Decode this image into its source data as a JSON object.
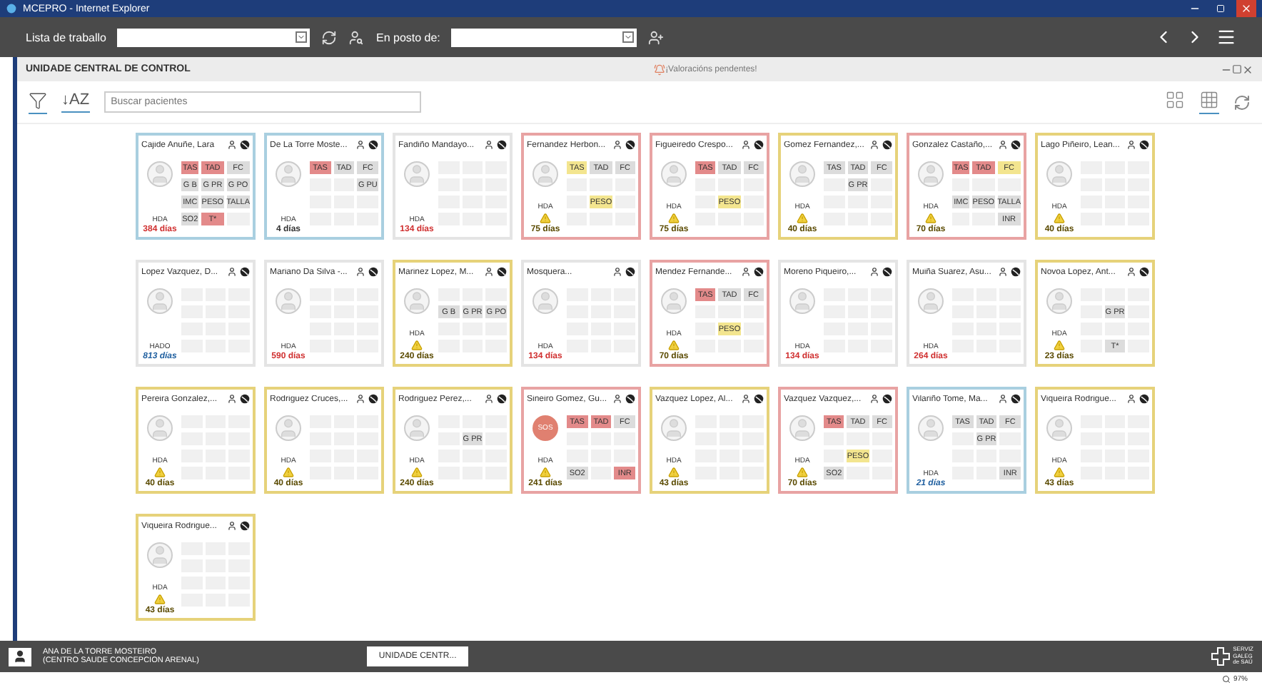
{
  "window": {
    "title": "MCEPRO - Internet Explorer"
  },
  "toolbar": {
    "worklist_label": "Lista de traballo",
    "post_label": "En posto de:"
  },
  "section": {
    "title": "UNIDADE CENTRAL DE CONTROL",
    "notice": "¡Valoracións pendentes!"
  },
  "filter_bar": {
    "sort": "↓AZ",
    "search": {
      "placeholder": "Buscar pacientes"
    },
    "views": [
      {
        "kind": "large",
        "selected": false
      },
      {
        "kind": "small",
        "selected": true
      }
    ]
  },
  "patients": [
    {
      "name": "Cajide Anuñe, Lara",
      "color": "#a9cfe0",
      "avatar": {
        "kind": "photo"
      },
      "program": "HDA",
      "warning": false,
      "days": {
        "text": "384 días",
        "color": "#d03030",
        "italic": false
      },
      "rows": [
        [
          {
            "text": "TAS",
            "kind": "alarm"
          },
          {
            "text": "TAD",
            "kind": "alarm"
          },
          {
            "text": "FC",
            "kind": "normal"
          }
        ],
        [
          {
            "text": "G B",
            "kind": "normal"
          },
          {
            "text": "G PR",
            "kind": "normal"
          },
          {
            "text": "G PO",
            "kind": "normal"
          }
        ],
        [
          {
            "text": "IMC",
            "kind": "normal"
          },
          {
            "text": "PESO",
            "kind": "normal"
          },
          {
            "text": "TALLA",
            "kind": "normal"
          }
        ],
        [
          {
            "text": "SO2",
            "kind": "normal"
          },
          {
            "text": "T*",
            "kind": "alarm"
          },
          {
            "kind": "empty"
          }
        ]
      ]
    },
    {
      "name": "De La Torre Moste...",
      "color": "#a9cfe0",
      "avatar": {
        "kind": "photo"
      },
      "program": "HDA",
      "warning": false,
      "days": {
        "text": "4 días",
        "color": "#333333",
        "italic": false
      },
      "rows": [
        [
          {
            "text": "TAS",
            "kind": "alarm"
          },
          {
            "text": "TAD",
            "kind": "normal"
          },
          {
            "text": "FC",
            "kind": "normal"
          }
        ],
        [
          {
            "kind": "empty"
          },
          {
            "kind": "empty"
          },
          {
            "text": "G PU",
            "kind": "normal"
          }
        ],
        [
          {
            "kind": "empty"
          },
          {
            "kind": "empty"
          },
          {
            "kind": "empty"
          }
        ],
        [
          {
            "kind": "empty"
          },
          {
            "kind": "empty"
          },
          {
            "kind": "empty"
          }
        ]
      ]
    },
    {
      "name": "Fandiño Mandayo...",
      "color": "#e4e4e4",
      "avatar": {
        "kind": "photo"
      },
      "program": "HDA",
      "warning": false,
      "days": {
        "text": "134 días",
        "color": "#d03030",
        "italic": false
      },
      "rows": [
        [
          {
            "kind": "empty"
          },
          {
            "kind": "empty"
          },
          {
            "kind": "empty"
          }
        ],
        [
          {
            "kind": "empty"
          },
          {
            "kind": "empty"
          },
          {
            "kind": "empty"
          }
        ],
        [
          {
            "kind": "empty"
          },
          {
            "kind": "empty"
          },
          {
            "kind": "empty"
          }
        ],
        [
          {
            "kind": "empty"
          },
          {
            "kind": "empty"
          },
          {
            "kind": "empty"
          }
        ]
      ]
    },
    {
      "name": "Fernandez Herbon...",
      "color": "#e8a3a3",
      "avatar": {
        "kind": "photo"
      },
      "program": "HDA",
      "warning": true,
      "days": {
        "text": "75 días",
        "color": "#5a4a00",
        "italic": false
      },
      "rows": [
        [
          {
            "text": "TAS",
            "kind": "warning"
          },
          {
            "text": "TAD",
            "kind": "normal"
          },
          {
            "text": "FC",
            "kind": "normal"
          }
        ],
        [
          {
            "kind": "empty"
          },
          {
            "kind": "empty"
          },
          {
            "kind": "empty"
          }
        ],
        [
          {
            "kind": "empty"
          },
          {
            "text": "PESO",
            "kind": "warning"
          },
          {
            "kind": "empty"
          }
        ],
        [
          {
            "kind": "empty"
          },
          {
            "kind": "empty"
          },
          {
            "kind": "empty"
          }
        ]
      ]
    },
    {
      "name": "Figueiredo Crespo...",
      "color": "#e8a3a3",
      "avatar": {
        "kind": "photo"
      },
      "program": "HDA",
      "warning": true,
      "days": {
        "text": "75 días",
        "color": "#5a4a00",
        "italic": false
      },
      "rows": [
        [
          {
            "text": "TAS",
            "kind": "alarm"
          },
          {
            "text": "TAD",
            "kind": "normal"
          },
          {
            "text": "FC",
            "kind": "normal"
          }
        ],
        [
          {
            "kind": "empty"
          },
          {
            "kind": "empty"
          },
          {
            "kind": "empty"
          }
        ],
        [
          {
            "kind": "empty"
          },
          {
            "text": "PESO",
            "kind": "warning"
          },
          {
            "kind": "empty"
          }
        ],
        [
          {
            "kind": "empty"
          },
          {
            "kind": "empty"
          },
          {
            "kind": "empty"
          }
        ]
      ]
    },
    {
      "name": "Gomez Fernandez,...",
      "color": "#e6d27a",
      "avatar": {
        "kind": "photo"
      },
      "program": "HDA",
      "warning": true,
      "days": {
        "text": "40 días",
        "color": "#5a4a00",
        "italic": false
      },
      "rows": [
        [
          {
            "text": "TAS",
            "kind": "normal"
          },
          {
            "text": "TAD",
            "kind": "normal"
          },
          {
            "text": "FC",
            "kind": "normal"
          }
        ],
        [
          {
            "kind": "empty"
          },
          {
            "text": "G PR",
            "kind": "normal"
          },
          {
            "kind": "empty"
          }
        ],
        [
          {
            "kind": "empty"
          },
          {
            "kind": "empty"
          },
          {
            "kind": "empty"
          }
        ],
        [
          {
            "kind": "empty"
          },
          {
            "kind": "empty"
          },
          {
            "kind": "empty"
          }
        ]
      ]
    },
    {
      "name": "Gonzalez Castaño,...",
      "color": "#e8a3a3",
      "avatar": {
        "kind": "photo"
      },
      "program": "HDA",
      "warning": true,
      "days": {
        "text": "70 días",
        "color": "#5a4a00",
        "italic": false
      },
      "rows": [
        [
          {
            "text": "TAS",
            "kind": "alarm"
          },
          {
            "text": "TAD",
            "kind": "alarm"
          },
          {
            "text": "FC",
            "kind": "warning"
          }
        ],
        [
          {
            "kind": "empty"
          },
          {
            "kind": "empty"
          },
          {
            "kind": "empty"
          }
        ],
        [
          {
            "text": "IMC",
            "kind": "normal"
          },
          {
            "text": "PESO",
            "kind": "normal"
          },
          {
            "text": "TALLA",
            "kind": "normal"
          }
        ],
        [
          {
            "kind": "empty"
          },
          {
            "kind": "empty"
          },
          {
            "text": "INR",
            "kind": "normal"
          }
        ]
      ]
    },
    {
      "name": "Lago Piñeiro, Lean...",
      "color": "#e6d27a",
      "avatar": {
        "kind": "photo"
      },
      "program": "HDA",
      "warning": true,
      "days": {
        "text": "40 días",
        "color": "#5a4a00",
        "italic": false
      },
      "rows": [
        [
          {
            "kind": "empty"
          },
          {
            "kind": "empty"
          },
          {
            "kind": "empty"
          }
        ],
        [
          {
            "kind": "empty"
          },
          {
            "kind": "empty"
          },
          {
            "kind": "empty"
          }
        ],
        [
          {
            "kind": "empty"
          },
          {
            "kind": "empty"
          },
          {
            "kind": "empty"
          }
        ],
        [
          {
            "kind": "empty"
          },
          {
            "kind": "empty"
          },
          {
            "kind": "empty"
          }
        ]
      ]
    },
    {
      "name": "Lopez Vazquez, D...",
      "color": "#e4e4e4",
      "avatar": {
        "kind": "photo"
      },
      "program": "HADO",
      "warning": false,
      "days": {
        "text": "813 días",
        "color": "#2060a0",
        "italic": true
      },
      "rows": [
        [
          {
            "kind": "empty"
          },
          {
            "kind": "empty"
          },
          {
            "kind": "empty"
          }
        ],
        [
          {
            "kind": "empty"
          },
          {
            "kind": "empty"
          },
          {
            "kind": "empty"
          }
        ],
        [
          {
            "kind": "empty"
          },
          {
            "kind": "empty"
          },
          {
            "kind": "empty"
          }
        ],
        [
          {
            "kind": "empty"
          },
          {
            "kind": "empty"
          },
          {
            "kind": "empty"
          }
        ]
      ]
    },
    {
      "name": "Mariano Da Silva -...",
      "color": "#e4e4e4",
      "avatar": {
        "kind": "photo"
      },
      "program": "HDA",
      "warning": false,
      "days": {
        "text": "590 días",
        "color": "#d03030",
        "italic": false
      },
      "rows": [
        [
          {
            "kind": "empty"
          },
          {
            "kind": "empty"
          },
          {
            "kind": "empty"
          }
        ],
        [
          {
            "kind": "empty"
          },
          {
            "kind": "empty"
          },
          {
            "kind": "empty"
          }
        ],
        [
          {
            "kind": "empty"
          },
          {
            "kind": "empty"
          },
          {
            "kind": "empty"
          }
        ],
        [
          {
            "kind": "empty"
          },
          {
            "kind": "empty"
          },
          {
            "kind": "empty"
          }
        ]
      ]
    },
    {
      "name": "Marinez Lopez, M...",
      "color": "#e6d27a",
      "avatar": {
        "kind": "photo"
      },
      "program": "HDA",
      "warning": true,
      "days": {
        "text": "240 días",
        "color": "#5a4a00",
        "italic": false
      },
      "rows": [
        [
          {
            "kind": "empty"
          },
          {
            "kind": "empty"
          },
          {
            "kind": "empty"
          }
        ],
        [
          {
            "text": "G B",
            "kind": "normal"
          },
          {
            "text": "G PR",
            "kind": "normal"
          },
          {
            "text": "G PO",
            "kind": "normal"
          }
        ],
        [
          {
            "kind": "empty"
          },
          {
            "kind": "empty"
          },
          {
            "kind": "empty"
          }
        ],
        [
          {
            "kind": "empty"
          },
          {
            "kind": "empty"
          },
          {
            "kind": "empty"
          }
        ]
      ]
    },
    {
      "name": "Mosquera...",
      "color": "#e4e4e4",
      "avatar": {
        "kind": "photo"
      },
      "program": "HDA",
      "warning": false,
      "days": {
        "text": "134 días",
        "color": "#d03030",
        "italic": false
      },
      "rows": [
        [
          {
            "kind": "empty"
          },
          {
            "kind": "empty"
          },
          {
            "kind": "empty"
          }
        ],
        [
          {
            "kind": "empty"
          },
          {
            "kind": "empty"
          },
          {
            "kind": "empty"
          }
        ],
        [
          {
            "kind": "empty"
          },
          {
            "kind": "empty"
          },
          {
            "kind": "empty"
          }
        ],
        [
          {
            "kind": "empty"
          },
          {
            "kind": "empty"
          },
          {
            "kind": "empty"
          }
        ]
      ]
    },
    {
      "name": "Mendez Fernande...",
      "color": "#e8a3a3",
      "avatar": {
        "kind": "photo"
      },
      "program": "HDA",
      "warning": true,
      "days": {
        "text": "70 días",
        "color": "#5a4a00",
        "italic": false
      },
      "rows": [
        [
          {
            "text": "TAS",
            "kind": "alarm"
          },
          {
            "text": "TAD",
            "kind": "normal"
          },
          {
            "text": "FC",
            "kind": "normal"
          }
        ],
        [
          {
            "kind": "empty"
          },
          {
            "kind": "empty"
          },
          {
            "kind": "empty"
          }
        ],
        [
          {
            "kind": "empty"
          },
          {
            "text": "PESO",
            "kind": "warning"
          },
          {
            "kind": "empty"
          }
        ],
        [
          {
            "kind": "empty"
          },
          {
            "kind": "empty"
          },
          {
            "kind": "empty"
          }
        ]
      ]
    },
    {
      "name": "Moreno Piqueiro,...",
      "color": "#e4e4e4",
      "avatar": {
        "kind": "photo"
      },
      "program": "HDA",
      "warning": false,
      "days": {
        "text": "134 días",
        "color": "#d03030",
        "italic": false
      },
      "rows": [
        [
          {
            "kind": "empty"
          },
          {
            "kind": "empty"
          },
          {
            "kind": "empty"
          }
        ],
        [
          {
            "kind": "empty"
          },
          {
            "kind": "empty"
          },
          {
            "kind": "empty"
          }
        ],
        [
          {
            "kind": "empty"
          },
          {
            "kind": "empty"
          },
          {
            "kind": "empty"
          }
        ],
        [
          {
            "kind": "empty"
          },
          {
            "kind": "empty"
          },
          {
            "kind": "empty"
          }
        ]
      ]
    },
    {
      "name": "Muiña Suarez, Asu...",
      "color": "#e4e4e4",
      "avatar": {
        "kind": "photo"
      },
      "program": "HDA",
      "warning": false,
      "days": {
        "text": "264 días",
        "color": "#d03030",
        "italic": false
      },
      "rows": [
        [
          {
            "kind": "empty"
          },
          {
            "kind": "empty"
          },
          {
            "kind": "empty"
          }
        ],
        [
          {
            "kind": "empty"
          },
          {
            "kind": "empty"
          },
          {
            "kind": "empty"
          }
        ],
        [
          {
            "kind": "empty"
          },
          {
            "kind": "empty"
          },
          {
            "kind": "empty"
          }
        ],
        [
          {
            "kind": "empty"
          },
          {
            "kind": "empty"
          },
          {
            "kind": "empty"
          }
        ]
      ]
    },
    {
      "name": "Novoa Lopez, Ant...",
      "color": "#e6d27a",
      "avatar": {
        "kind": "photo"
      },
      "program": "HDA",
      "warning": true,
      "days": {
        "text": "23 días",
        "color": "#5a4a00",
        "italic": false
      },
      "rows": [
        [
          {
            "kind": "empty"
          },
          {
            "kind": "empty"
          },
          {
            "kind": "empty"
          }
        ],
        [
          {
            "kind": "empty"
          },
          {
            "text": "G PR",
            "kind": "normal"
          },
          {
            "kind": "empty"
          }
        ],
        [
          {
            "kind": "empty"
          },
          {
            "kind": "empty"
          },
          {
            "kind": "empty"
          }
        ],
        [
          {
            "kind": "empty"
          },
          {
            "text": "T*",
            "kind": "normal"
          },
          {
            "kind": "empty"
          }
        ]
      ]
    },
    {
      "name": "Pereira Gonzalez,...",
      "color": "#e6d27a",
      "avatar": {
        "kind": "photo"
      },
      "program": "HDA",
      "warning": true,
      "days": {
        "text": "40 días",
        "color": "#5a4a00",
        "italic": false
      },
      "rows": [
        [
          {
            "kind": "empty"
          },
          {
            "kind": "empty"
          },
          {
            "kind": "empty"
          }
        ],
        [
          {
            "kind": "empty"
          },
          {
            "kind": "empty"
          },
          {
            "kind": "empty"
          }
        ],
        [
          {
            "kind": "empty"
          },
          {
            "kind": "empty"
          },
          {
            "kind": "empty"
          }
        ],
        [
          {
            "kind": "empty"
          },
          {
            "kind": "empty"
          },
          {
            "kind": "empty"
          }
        ]
      ]
    },
    {
      "name": "Rodriguez Cruces,...",
      "color": "#e6d27a",
      "avatar": {
        "kind": "photo"
      },
      "program": "HDA",
      "warning": true,
      "days": {
        "text": "40 días",
        "color": "#5a4a00",
        "italic": false
      },
      "rows": [
        [
          {
            "kind": "empty"
          },
          {
            "kind": "empty"
          },
          {
            "kind": "empty"
          }
        ],
        [
          {
            "kind": "empty"
          },
          {
            "kind": "empty"
          },
          {
            "kind": "empty"
          }
        ],
        [
          {
            "kind": "empty"
          },
          {
            "kind": "empty"
          },
          {
            "kind": "empty"
          }
        ],
        [
          {
            "kind": "empty"
          },
          {
            "kind": "empty"
          },
          {
            "kind": "empty"
          }
        ]
      ]
    },
    {
      "name": "Rodriguez Perez,...",
      "color": "#e6d27a",
      "avatar": {
        "kind": "photo"
      },
      "program": "HDA",
      "warning": true,
      "days": {
        "text": "240 días",
        "color": "#5a4a00",
        "italic": false
      },
      "rows": [
        [
          {
            "kind": "empty"
          },
          {
            "kind": "empty"
          },
          {
            "kind": "empty"
          }
        ],
        [
          {
            "kind": "empty"
          },
          {
            "text": "G PR",
            "kind": "normal"
          },
          {
            "kind": "empty"
          }
        ],
        [
          {
            "kind": "empty"
          },
          {
            "kind": "empty"
          },
          {
            "kind": "empty"
          }
        ],
        [
          {
            "kind": "empty"
          },
          {
            "kind": "empty"
          },
          {
            "kind": "empty"
          }
        ]
      ]
    },
    {
      "name": "Sineiro Gomez, Gu...",
      "color": "#e8a3a3",
      "avatar": {
        "kind": "sos",
        "text": "SOS"
      },
      "program": "HDA",
      "warning": true,
      "days": {
        "text": "241 días",
        "color": "#5a4a00",
        "italic": false
      },
      "rows": [
        [
          {
            "text": "TAS",
            "kind": "alarm"
          },
          {
            "text": "TAD",
            "kind": "alarm"
          },
          {
            "text": "FC",
            "kind": "normal"
          }
        ],
        [
          {
            "kind": "empty"
          },
          {
            "kind": "empty"
          },
          {
            "kind": "empty"
          }
        ],
        [
          {
            "kind": "empty"
          },
          {
            "kind": "empty"
          },
          {
            "kind": "empty"
          }
        ],
        [
          {
            "text": "SO2",
            "kind": "normal"
          },
          {
            "kind": "empty"
          },
          {
            "text": "INR",
            "kind": "alarm"
          }
        ]
      ]
    },
    {
      "name": "Vazquez Lopez, Al...",
      "color": "#e6d27a",
      "avatar": {
        "kind": "photo"
      },
      "program": "HDA",
      "warning": true,
      "days": {
        "text": "43 días",
        "color": "#5a4a00",
        "italic": false
      },
      "rows": [
        [
          {
            "kind": "empty"
          },
          {
            "kind": "empty"
          },
          {
            "kind": "empty"
          }
        ],
        [
          {
            "kind": "empty"
          },
          {
            "kind": "empty"
          },
          {
            "kind": "empty"
          }
        ],
        [
          {
            "kind": "empty"
          },
          {
            "kind": "empty"
          },
          {
            "kind": "empty"
          }
        ],
        [
          {
            "kind": "empty"
          },
          {
            "kind": "empty"
          },
          {
            "kind": "empty"
          }
        ]
      ]
    },
    {
      "name": "Vazquez Vazquez,...",
      "color": "#e8a3a3",
      "avatar": {
        "kind": "photo"
      },
      "program": "HDA",
      "warning": true,
      "days": {
        "text": "70 días",
        "color": "#5a4a00",
        "italic": false
      },
      "rows": [
        [
          {
            "text": "TAS",
            "kind": "alarm"
          },
          {
            "text": "TAD",
            "kind": "normal"
          },
          {
            "text": "FC",
            "kind": "normal"
          }
        ],
        [
          {
            "kind": "empty"
          },
          {
            "kind": "empty"
          },
          {
            "kind": "empty"
          }
        ],
        [
          {
            "kind": "empty"
          },
          {
            "text": "PESO",
            "kind": "warning"
          },
          {
            "kind": "empty"
          }
        ],
        [
          {
            "text": "SO2",
            "kind": "normal"
          },
          {
            "kind": "empty"
          },
          {
            "kind": "empty"
          }
        ]
      ]
    },
    {
      "name": "Vilariño Tome, Ma...",
      "color": "#a9cfe0",
      "avatar": {
        "kind": "photo"
      },
      "program": "HDA",
      "warning": false,
      "days": {
        "text": "21 días",
        "color": "#2060a0",
        "italic": true
      },
      "rows": [
        [
          {
            "text": "TAS",
            "kind": "normal"
          },
          {
            "text": "TAD",
            "kind": "normal"
          },
          {
            "text": "FC",
            "kind": "normal"
          }
        ],
        [
          {
            "kind": "empty"
          },
          {
            "text": "G PR",
            "kind": "normal"
          },
          {
            "kind": "empty"
          }
        ],
        [
          {
            "kind": "empty"
          },
          {
            "kind": "empty"
          },
          {
            "kind": "empty"
          }
        ],
        [
          {
            "kind": "empty"
          },
          {
            "kind": "empty"
          },
          {
            "text": "INR",
            "kind": "normal"
          }
        ]
      ]
    },
    {
      "name": "Viqueira Rodrigue...",
      "color": "#e6d27a",
      "avatar": {
        "kind": "photo"
      },
      "program": "HDA",
      "warning": true,
      "days": {
        "text": "43 días",
        "color": "#5a4a00",
        "italic": false
      },
      "rows": [
        [
          {
            "kind": "empty"
          },
          {
            "kind": "empty"
          },
          {
            "kind": "empty"
          }
        ],
        [
          {
            "kind": "empty"
          },
          {
            "kind": "empty"
          },
          {
            "kind": "empty"
          }
        ],
        [
          {
            "kind": "empty"
          },
          {
            "kind": "empty"
          },
          {
            "kind": "empty"
          }
        ],
        [
          {
            "kind": "empty"
          },
          {
            "kind": "empty"
          },
          {
            "kind": "empty"
          }
        ]
      ]
    },
    {
      "name": "Viqueira Rodrigue...",
      "color": "#e6d27a",
      "avatar": {
        "kind": "photo"
      },
      "program": "HDA",
      "warning": true,
      "days": {
        "text": "43 días",
        "color": "#5a4a00",
        "italic": false
      },
      "rows": [
        [
          {
            "kind": "empty"
          },
          {
            "kind": "empty"
          },
          {
            "kind": "empty"
          }
        ],
        [
          {
            "kind": "empty"
          },
          {
            "kind": "empty"
          },
          {
            "kind": "empty"
          }
        ],
        [
          {
            "kind": "empty"
          },
          {
            "kind": "empty"
          },
          {
            "kind": "empty"
          }
        ],
        [
          {
            "kind": "empty"
          },
          {
            "kind": "empty"
          },
          {
            "kind": "empty"
          }
        ]
      ]
    }
  ],
  "footer": {
    "user": "ANA DE LA TORRE MOSTEIRO",
    "centre": "(CENTRO SAUDE CONCEPCION ARENAL)",
    "tabs": [
      {
        "label": "UNIDADE CENTR...",
        "selected": true
      }
    ],
    "logo_lines": [
      "SERVIZ",
      "GALEG",
      "de SAÚ"
    ]
  },
  "status_bar": {
    "zoom": "97%"
  }
}
